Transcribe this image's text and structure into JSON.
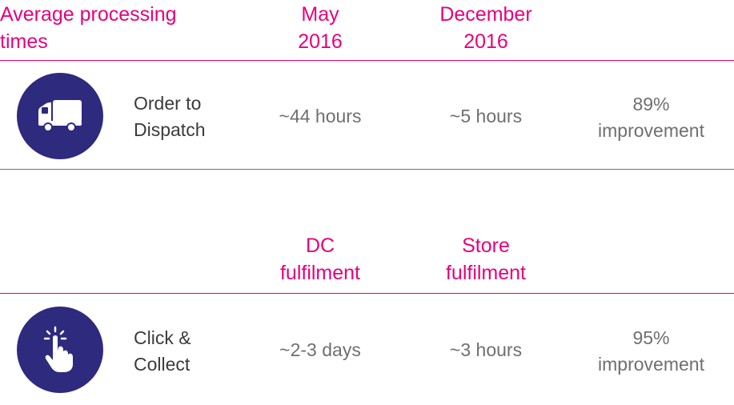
{
  "section1": {
    "header": {
      "title": "Average processing\ntimes",
      "col1": "May\n2016",
      "col2": "December\n2016"
    },
    "row": {
      "icon": "delivery-truck-icon",
      "label": "Order to\nDispatch",
      "col1_value": "~44 hours",
      "col2_value": "~5 hours",
      "improvement": "89%\nimprovement"
    }
  },
  "section2": {
    "header": {
      "col1": "DC\nfulfilment",
      "col2": "Store\nfulfilment"
    },
    "row": {
      "icon": "pointing-hand-tap-icon",
      "label": "Click &\nCollect",
      "col1_value": "~2-3 days",
      "col2_value": "~3 hours",
      "improvement": "95%\nimprovement"
    }
  },
  "colors": {
    "accent": "#e6007e",
    "icon_circle": "#2e2a7e",
    "label_text": "#3b3b3b",
    "value_text": "#6f6f6f"
  }
}
